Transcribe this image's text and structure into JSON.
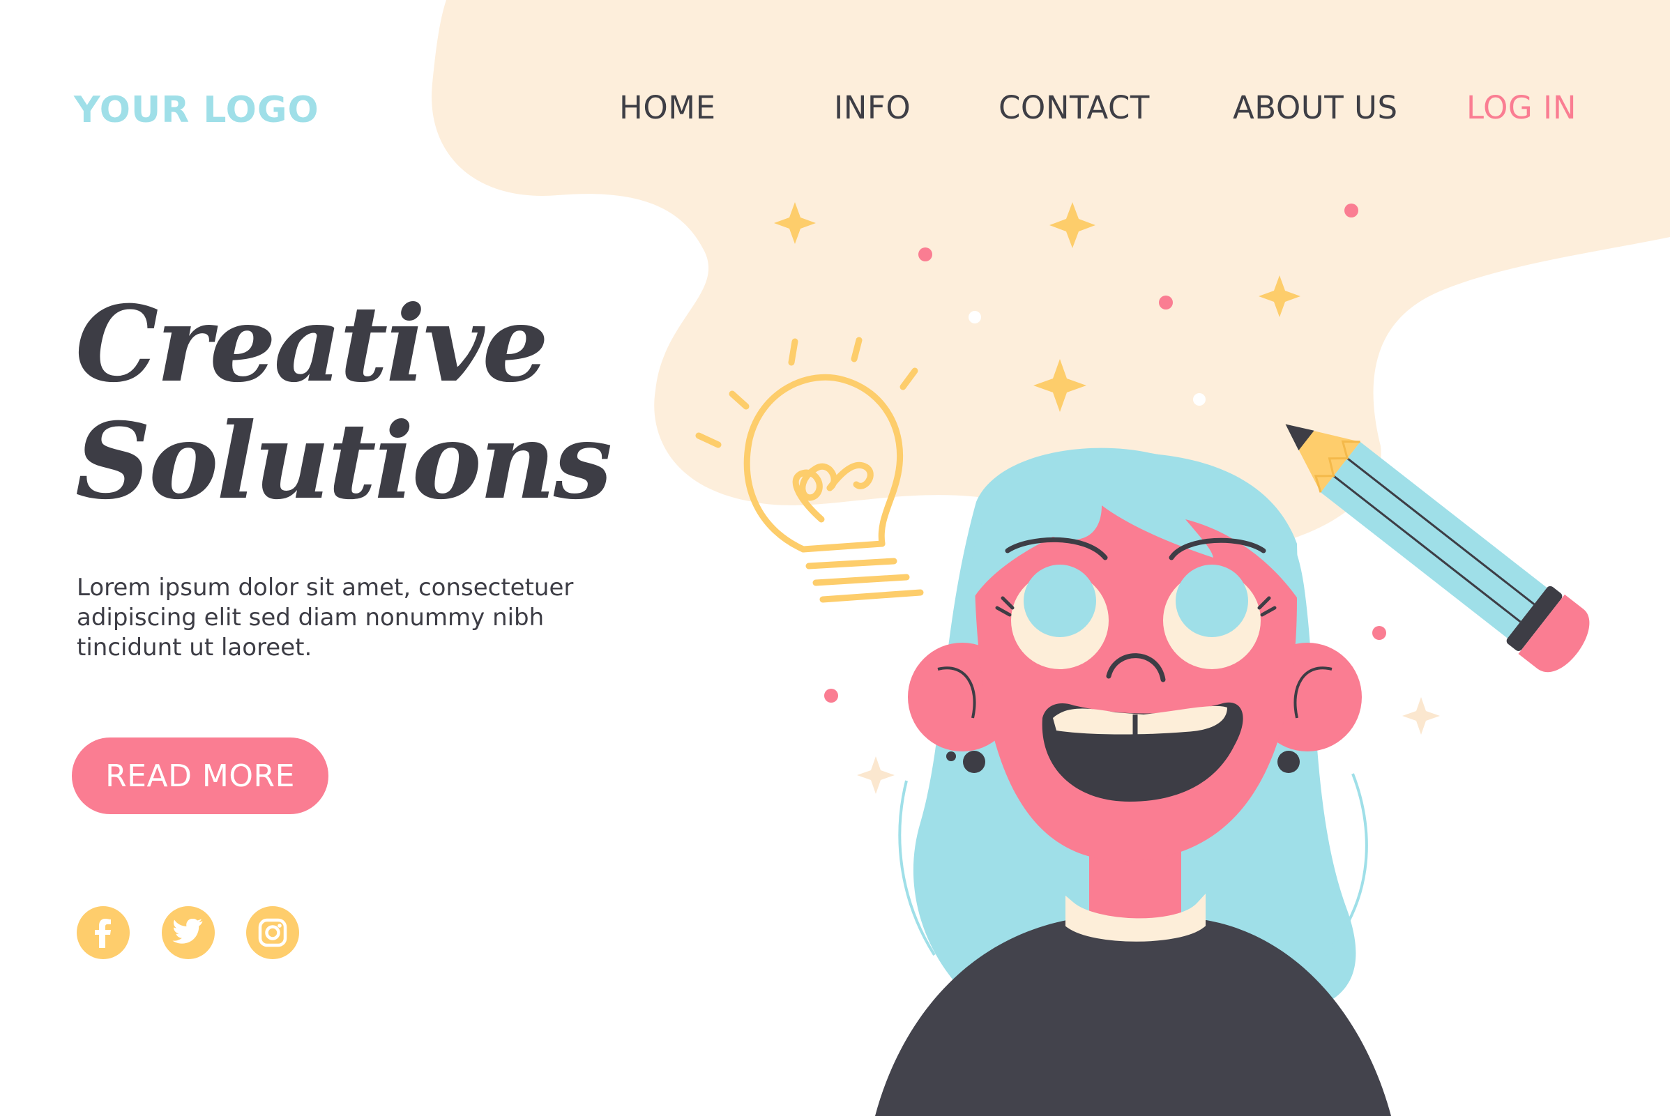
{
  "colors": {
    "brand_teal": "#9fdfe8",
    "accent_pink": "#fa7d92",
    "text_dark": "#3d3d45",
    "blob_peach": "#fdeedb",
    "social_yellow": "#fecd6c",
    "background": "#ffffff"
  },
  "header": {
    "logo": "YOUR LOGO",
    "nav": {
      "home": "HOME",
      "info": "INFO",
      "contact": "CONTACT",
      "about": "ABOUT US",
      "login": "LOG IN"
    }
  },
  "hero": {
    "title_line1": "Creative",
    "title_line2": "Solutions",
    "description": "Lorem ipsum dolor sit amet, consectetuer adipiscing elit sed diam nonummy nibh tincidunt ut laoreet.",
    "button_label": "READ MORE"
  },
  "social": [
    {
      "icon": "facebook-icon"
    },
    {
      "icon": "twitter-icon"
    },
    {
      "icon": "instagram-icon"
    }
  ]
}
